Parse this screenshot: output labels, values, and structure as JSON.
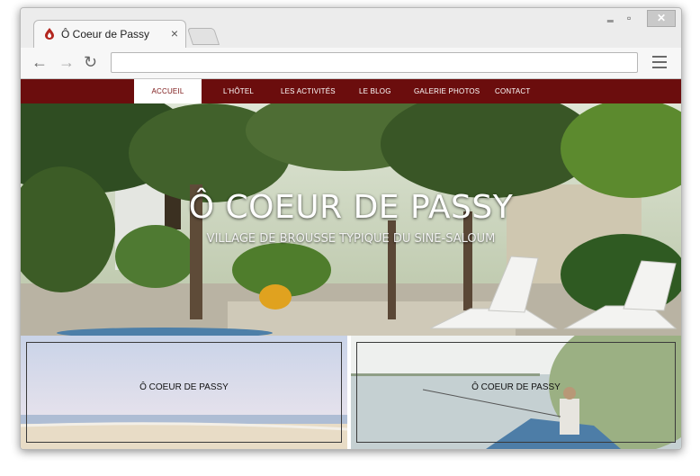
{
  "browser": {
    "tab_title": "Ô Coeur de Passy",
    "tab_close": "×",
    "back_icon": "←",
    "forward_icon": "→",
    "reload_icon": "↻",
    "address": "",
    "window_controls": {
      "minimize": "‗",
      "maximize": "▫",
      "close": "✕"
    }
  },
  "colors": {
    "nav_bg": "#6b0d0d",
    "active_text": "#7a1414",
    "favicon": "#b3261e"
  },
  "nav": {
    "items": [
      {
        "label": "Accueil",
        "active": true
      },
      {
        "label": "L'hôtel"
      },
      {
        "label": "Les activités"
      },
      {
        "label": "Le blog"
      },
      {
        "label": "Galerie photos"
      },
      {
        "label": "Contact"
      }
    ]
  },
  "hero": {
    "title": "Ô COEUR DE PASSY",
    "subtitle": "VILLAGE DE BROUSSE TYPIQUE DU SINE-SALOUM"
  },
  "cards": [
    {
      "label": "Ô Coeur de Passy"
    },
    {
      "label": "Ô Coeur de Passy"
    }
  ]
}
